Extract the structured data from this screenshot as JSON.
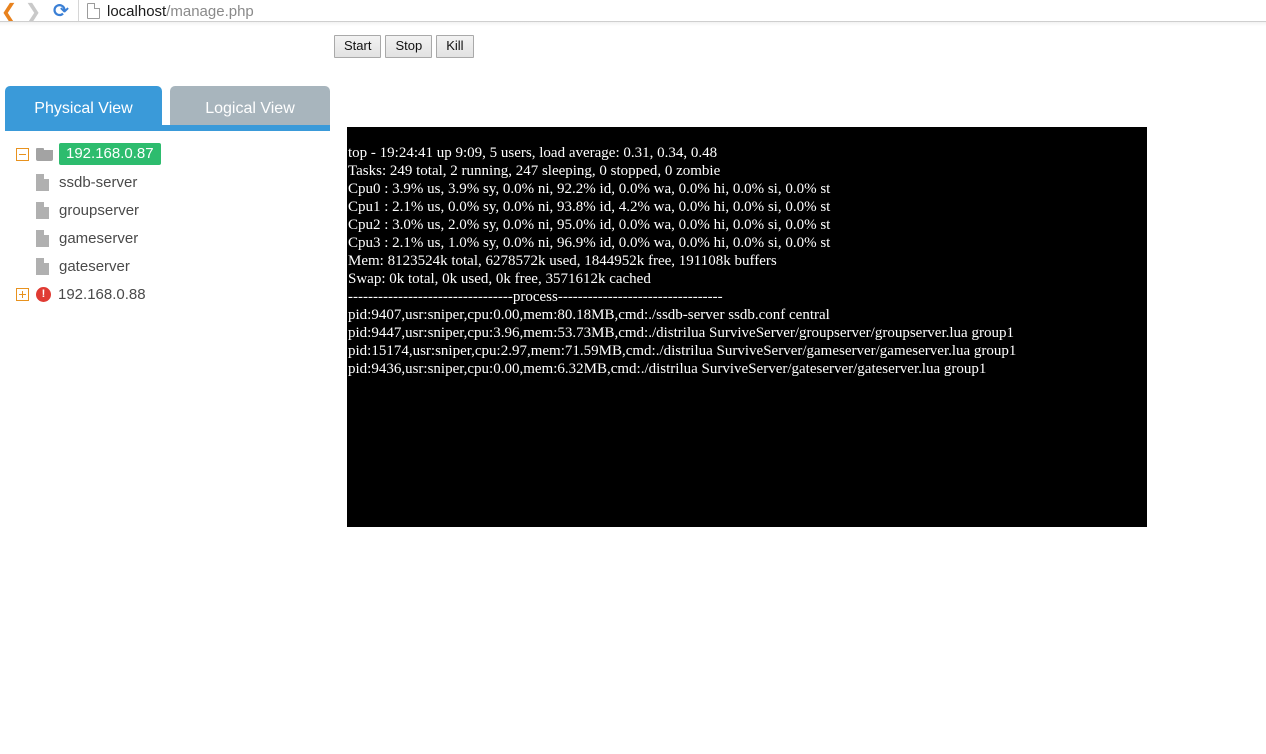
{
  "browser": {
    "back_icon": "back-arrow-icon",
    "forward_icon": "forward-arrow-icon",
    "reload_icon": "reload-icon",
    "page_icon": "page-document-icon",
    "url_host": "localhost",
    "url_path": "/manage.php"
  },
  "toolbar": {
    "buttons": [
      {
        "label": "Start",
        "name": "start-button"
      },
      {
        "label": "Stop",
        "name": "stop-button"
      },
      {
        "label": "Kill",
        "name": "kill-button"
      }
    ]
  },
  "tabs": {
    "active_index": 0,
    "items": [
      {
        "label": "Physical View",
        "active": true
      },
      {
        "label": "Logical View",
        "active": false
      }
    ],
    "active_color": "#3a9ad9",
    "inactive_color": "#a8b5bd"
  },
  "tree": {
    "highlight_color": "#2dbc6e",
    "nodes": [
      {
        "label": "192.168.0.87",
        "toggle": "minus",
        "icon": "open-folder-icon",
        "selected": true,
        "children": [
          {
            "label": "ssdb-server",
            "icon": "file-icon"
          },
          {
            "label": "groupserver",
            "icon": "file-icon"
          },
          {
            "label": "gameserver",
            "icon": "file-icon"
          },
          {
            "label": "gateserver",
            "icon": "file-icon"
          }
        ]
      },
      {
        "label": "192.168.0.88",
        "toggle": "plus",
        "icon": "error-circle-icon",
        "selected": false,
        "children": []
      }
    ]
  },
  "terminal": {
    "background": "#000000",
    "foreground": "#ffffff",
    "lines": [
      "top - 19:24:41 up 9:09, 5 users, load average: 0.31, 0.34, 0.48",
      "Tasks: 249 total, 2 running, 247 sleeping, 0 stopped, 0 zombie",
      "Cpu0 : 3.9% us, 3.9% sy, 0.0% ni, 92.2% id, 0.0% wa, 0.0% hi, 0.0% si, 0.0% st",
      "Cpu1 : 2.1% us, 0.0% sy, 0.0% ni, 93.8% id, 4.2% wa, 0.0% hi, 0.0% si, 0.0% st",
      "Cpu2 : 3.0% us, 2.0% sy, 0.0% ni, 95.0% id, 0.0% wa, 0.0% hi, 0.0% si, 0.0% st",
      "Cpu3 : 2.1% us, 1.0% sy, 0.0% ni, 96.9% id, 0.0% wa, 0.0% hi, 0.0% si, 0.0% st",
      "Mem: 8123524k total, 6278572k used, 1844952k free, 191108k buffers",
      "Swap: 0k total, 0k used, 0k free, 3571612k cached",
      "---------------------------------process---------------------------------",
      "pid:9407,usr:sniper,cpu:0.00,mem:80.18MB,cmd:./ssdb-server ssdb.conf central",
      "pid:9447,usr:sniper,cpu:3.96,mem:53.73MB,cmd:./distrilua SurviveServer/groupserver/groupserver.lua group1",
      "pid:15174,usr:sniper,cpu:2.97,mem:71.59MB,cmd:./distrilua SurviveServer/gameserver/gameserver.lua group1",
      "pid:9436,usr:sniper,cpu:0.00,mem:6.32MB,cmd:./distrilua SurviveServer/gateserver/gateserver.lua group1"
    ]
  }
}
